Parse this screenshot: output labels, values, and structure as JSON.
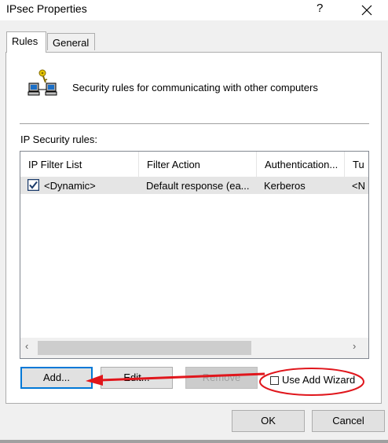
{
  "window": {
    "title": "IPsec Properties",
    "help_label": "?",
    "close_icon": "close-icon"
  },
  "tabs": [
    {
      "label": "Rules",
      "selected": true
    },
    {
      "label": "General",
      "selected": false
    }
  ],
  "header": {
    "icon": "network-computers-key-icon",
    "description": "Security rules for communicating with other computers"
  },
  "rules_list": {
    "label": "IP Security rules:",
    "columns": [
      "IP Filter List",
      "Filter Action",
      "Authentication...",
      "Tu"
    ],
    "rows": [
      {
        "checked": true,
        "filter_list": "<Dynamic>",
        "filter_action": "Default response (ea...",
        "authentication": "Kerberos",
        "tunnel": "<N"
      }
    ],
    "scroll_left": "‹",
    "scroll_right": "›"
  },
  "buttons": {
    "add": "Add...",
    "edit": "Edit...",
    "remove": "Remove",
    "ok": "OK",
    "cancel": "Cancel"
  },
  "use_add_wizard": {
    "label": "Use Add Wizard",
    "checked": false
  },
  "colors": {
    "annotation": "#e0161c",
    "accent": "#0078d7",
    "selected_row": "#e5e5e5"
  }
}
